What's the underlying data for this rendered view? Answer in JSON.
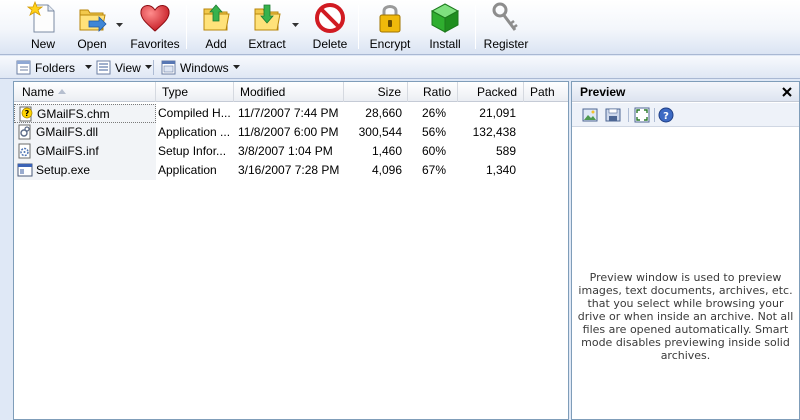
{
  "toolbar": {
    "buttons": [
      {
        "label": "New",
        "icon": "new-file-icon"
      },
      {
        "label": "Open",
        "icon": "open-folder-icon"
      },
      {
        "label": "Favorites",
        "icon": "heart-icon"
      },
      {
        "label": "Add",
        "icon": "add-folder-icon"
      },
      {
        "label": "Extract",
        "icon": "extract-folder-icon"
      },
      {
        "label": "Delete",
        "icon": "delete-icon"
      },
      {
        "label": "Encrypt",
        "icon": "padlock-icon"
      },
      {
        "label": "Install",
        "icon": "green-cube-icon"
      },
      {
        "label": "Register",
        "icon": "keys-icon"
      }
    ]
  },
  "toolbar2": {
    "folders": "Folders",
    "view": "View",
    "windows": "Windows"
  },
  "filelist": {
    "columns": [
      "Name",
      "Type",
      "Modified",
      "Size",
      "Ratio",
      "Packed",
      "Path"
    ],
    "rows": [
      {
        "name": "GMailFS.chm",
        "type": "Compiled H...",
        "modified": "11/7/2007 7:44 PM",
        "size": "28,660",
        "ratio": "26%",
        "packed": "21,091",
        "path": "",
        "icon": "chm-help-file-icon"
      },
      {
        "name": "GMailFS.dll",
        "type": "Application ...",
        "modified": "11/8/2007 6:00 PM",
        "size": "300,544",
        "ratio": "56%",
        "packed": "132,438",
        "path": "",
        "icon": "dll-file-icon"
      },
      {
        "name": "GMailFS.inf",
        "type": "Setup Infor...",
        "modified": "3/8/2007 1:04 PM",
        "size": "1,460",
        "ratio": "60%",
        "packed": "589",
        "path": "",
        "icon": "inf-file-icon"
      },
      {
        "name": "Setup.exe",
        "type": "Application",
        "modified": "3/16/2007 7:28 PM",
        "size": "4,096",
        "ratio": "67%",
        "packed": "1,340",
        "path": "",
        "icon": "exe-file-icon"
      }
    ]
  },
  "preview": {
    "title": "Preview",
    "message": "Preview window is used to preview images, text documents, archives, etc. that you select while browsing your drive or when inside an archive. Not all files are opened automatically. Smart mode disables previewing inside solid archives."
  },
  "colors": {
    "toolbar_bg": "#e9eef7",
    "border": "#7f9db9",
    "selection_outline": "#7a7a7a"
  }
}
